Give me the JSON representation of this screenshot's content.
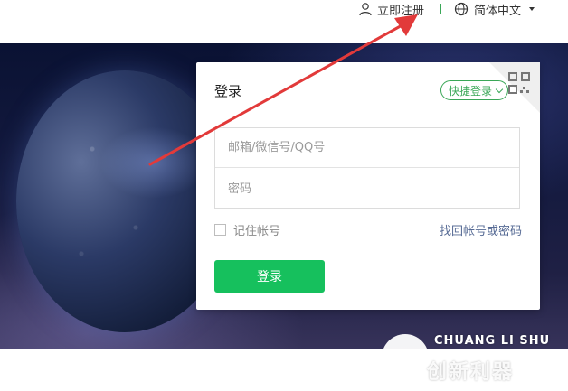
{
  "topbar": {
    "register_label": "立即注册",
    "language_label": "简体中文",
    "icons": {
      "user": "user-icon",
      "globe": "globe-icon",
      "caret": "caret-down-icon"
    }
  },
  "login": {
    "title": "登录",
    "quick_login_label": "快捷登录",
    "account_placeholder": "邮箱/微信号/QQ号",
    "password_placeholder": "密码",
    "remember_label": "记住帐号",
    "forgot_label": "找回帐号或密码",
    "submit_label": "登录",
    "icons": {
      "qr": "qr-code-icon",
      "chevron": "chevron-down-icon"
    }
  },
  "watermark": {
    "latin": "CHUANG LI SHU",
    "cn": "创新利器"
  },
  "colors": {
    "accent_green": "#16c05d",
    "outline_green": "#3aa757",
    "link_blue": "#576b95",
    "annotation_red": "#e23a3a"
  }
}
